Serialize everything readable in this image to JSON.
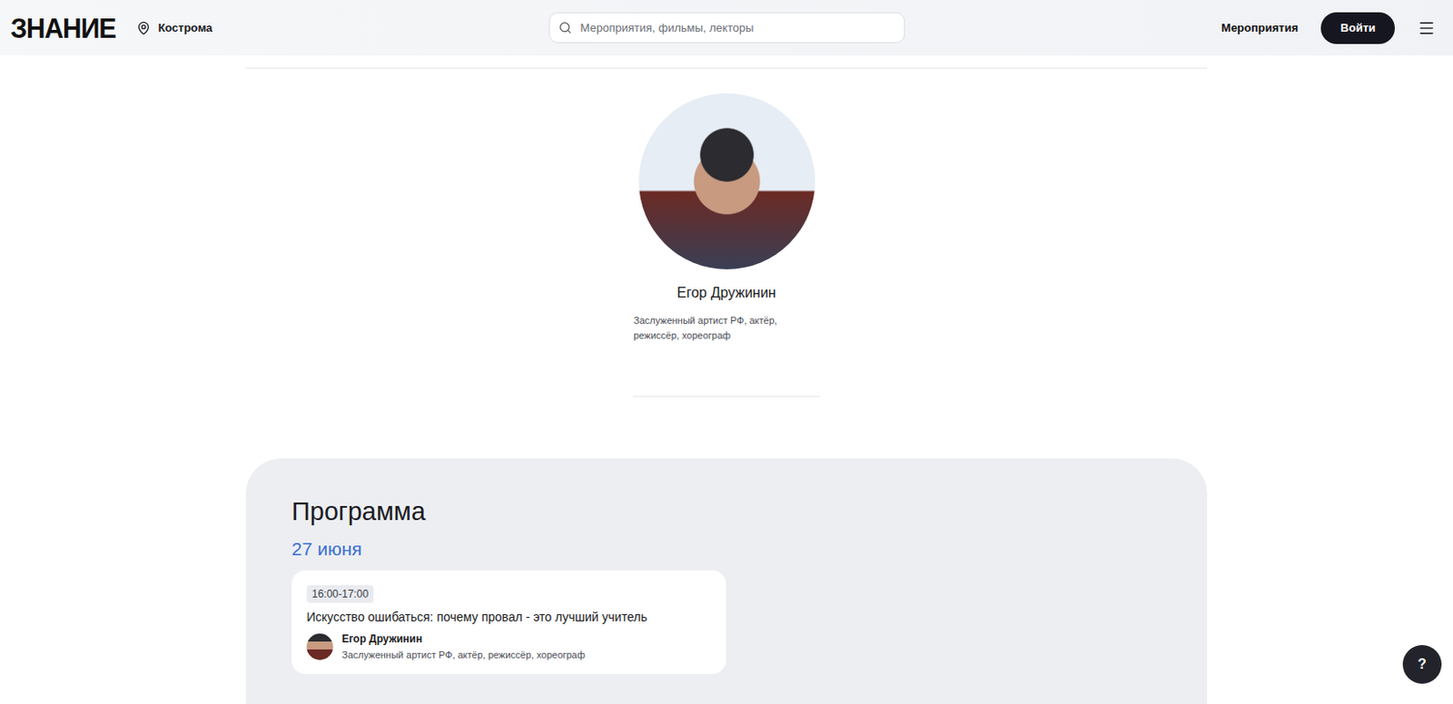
{
  "header": {
    "logo": "ЗНАНИЕ",
    "location": "Кострома",
    "search": {
      "placeholder": "Мероприятия, фильмы, лекторы"
    },
    "nav": [
      "Мероприятия"
    ],
    "login": "Войти"
  },
  "lecturer": {
    "name": "Егор Дружинин",
    "title": "Заслуженный артист РФ, актёр, режиссёр, хореограф"
  },
  "program": {
    "title": "Программа",
    "days": [
      {
        "date": "27 июня",
        "sessions": [
          {
            "time": "16:00-17:00",
            "title": "Искусство ошибаться: почему провал - это лучший учитель",
            "speaker": {
              "name": "Егор Дружинин",
              "role": "Заслуженный артист РФ, актёр, режиссёр, хореограф"
            }
          }
        ]
      }
    ]
  },
  "help": {
    "label": "?"
  }
}
